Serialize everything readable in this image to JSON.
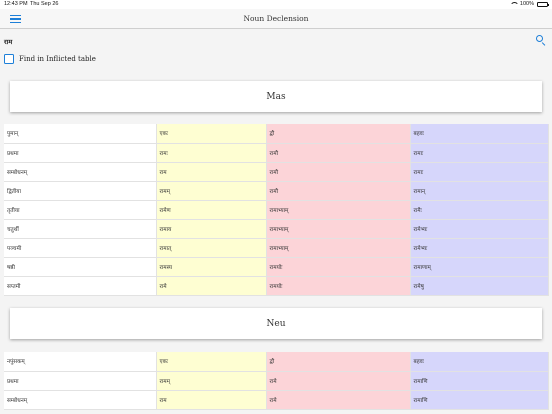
{
  "status_bar": {
    "time": "12:43 PM",
    "date": "Thu Sep 26",
    "battery": "100%"
  },
  "nav": {
    "title": "Noun Declension"
  },
  "search": {
    "query": "राम"
  },
  "find_option": {
    "label": "Find in Inflicted table",
    "checked": false
  },
  "colors": {
    "accent": "#1d7fd8",
    "singular": "#fefed2",
    "dual": "#fcd4d8",
    "plural": "#d6d6fb"
  },
  "sections": {
    "mas": {
      "title": "Mas",
      "header": [
        "पुमान्",
        "एकः",
        "द्वौ",
        "बहवः"
      ],
      "rows": [
        [
          "प्रथमा",
          "रामः",
          "रामौ",
          "रामाः"
        ],
        [
          "सम्बोधनम्",
          "राम",
          "रामौ",
          "रामाः"
        ],
        [
          "द्वितीया",
          "रामम्",
          "रामौ",
          "रामान्"
        ],
        [
          "तृतीया",
          "रामेण",
          "रामाभ्याम्",
          "रामैः"
        ],
        [
          "चतुर्थी",
          "रामाय",
          "रामाभ्याम्",
          "रामेभ्यः"
        ],
        [
          "पञ्चमी",
          "रामात्",
          "रामाभ्याम्",
          "रामेभ्यः"
        ],
        [
          "षष्ठी",
          "रामस्य",
          "रामयोः",
          "रामाणाम्"
        ],
        [
          "सप्तमी",
          "रामे",
          "रामयोः",
          "रामेषु"
        ]
      ]
    },
    "neu": {
      "title": "Neu",
      "header": [
        "नपुंसकम्",
        "एकः",
        "द्वौ",
        "बहवः"
      ],
      "rows": [
        [
          "प्रथमा",
          "रामम्",
          "रामे",
          "रामाणि"
        ],
        [
          "सम्बोधनम्",
          "राम",
          "रामे",
          "रामाणि"
        ]
      ]
    }
  }
}
